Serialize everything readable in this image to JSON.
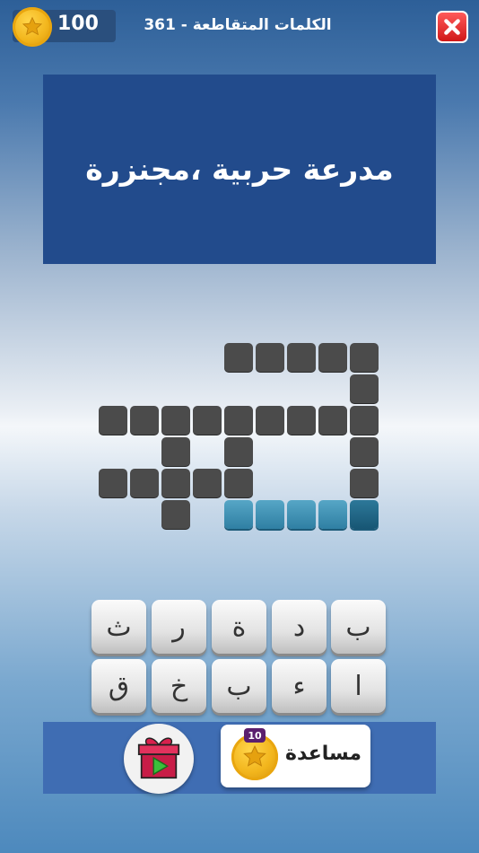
{
  "header": {
    "coins": "100",
    "title": "361 - الكلمات المتقاطعة",
    "close_icon": "close-icon",
    "close_color": "#e02424"
  },
  "clue": {
    "text": "مدرعة حربية ،مجنزرة"
  },
  "grid": {
    "filled_color": "#4b4b4b",
    "answer_color": "#3b8db3",
    "current_answer_length": 5
  },
  "keyboard": {
    "row1": [
      "ب",
      "د",
      "ة",
      "ر",
      "ث"
    ],
    "row2": [
      "ا",
      "ء",
      "ب",
      "خ",
      "ق"
    ]
  },
  "bottom": {
    "gift_icon": "gift-video-icon",
    "help_cost": "10",
    "help_label": "مساعدة"
  },
  "colors": {
    "clue_panel": "#224b8c",
    "bottom_bar": "#3f6db3",
    "coin": "#f2b51c"
  }
}
